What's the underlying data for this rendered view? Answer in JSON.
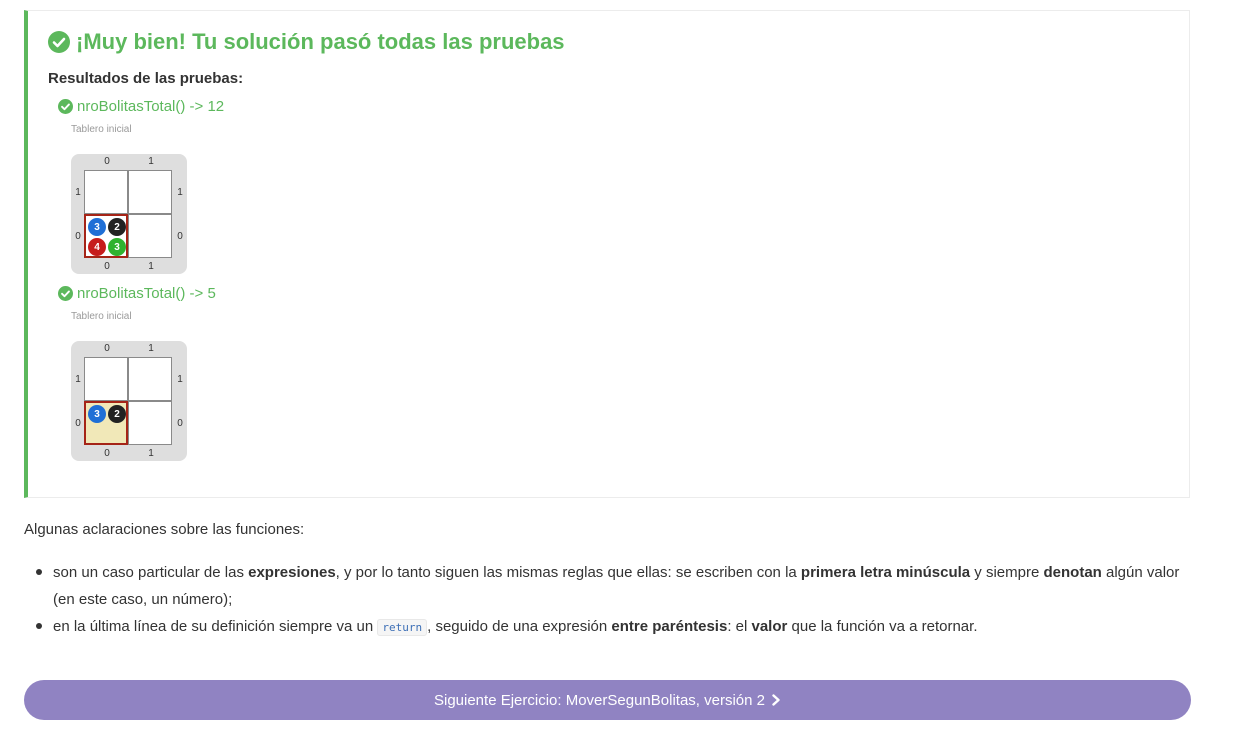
{
  "result": {
    "title": "¡Muy bien! Tu solución pasó todas las pruebas",
    "results_label": "Resultados de las pruebas:",
    "success_color": "#5cb85c",
    "tests": [
      {
        "label": "nroBolitasTotal() -> 12",
        "board_caption": "Tablero inicial",
        "col_labels": [
          "0",
          "1"
        ],
        "row_labels": [
          "1",
          "0"
        ],
        "balls": [
          {
            "color": "azul",
            "count": "3"
          },
          {
            "color": "negro",
            "count": "2"
          },
          {
            "color": "rojo",
            "count": "4"
          },
          {
            "color": "verde",
            "count": "3"
          }
        ]
      },
      {
        "label": "nroBolitasTotal() -> 5",
        "board_caption": "Tablero inicial",
        "col_labels": [
          "0",
          "1"
        ],
        "row_labels": [
          "1",
          "0"
        ],
        "balls": [
          {
            "color": "azul",
            "count": "3"
          },
          {
            "color": "negro",
            "count": "2"
          }
        ]
      }
    ]
  },
  "notes": {
    "intro": "Algunas aclaraciones sobre las funciones:",
    "item1": {
      "t1": "son un caso particular de las ",
      "b1": "expresiones",
      "t2": ", y por lo tanto siguen las mismas reglas que ellas: se escriben con la ",
      "b2": "primera letra minúscula",
      "t3": " y siempre ",
      "b3": "denotan",
      "t4": " algún valor (en este caso, un número);"
    },
    "item2": {
      "t1": "en la última línea de su definición siempre va un ",
      "code": "return",
      "t2": ", seguido de una expresión ",
      "b1": "entre paréntesis",
      "t3": ": el ",
      "b2": "valor",
      "t4": " que la función va a retornar."
    }
  },
  "next_button": {
    "label": "Siguiente Ejercicio: MoverSegunBolitas, versión 2",
    "icon": "chevron-right-icon",
    "color": "#9083c2"
  },
  "ball_colors": {
    "azul": "#1f6fd6",
    "negro": "#222222",
    "rojo": "#c61c1c",
    "verde": "#2fb22f"
  }
}
